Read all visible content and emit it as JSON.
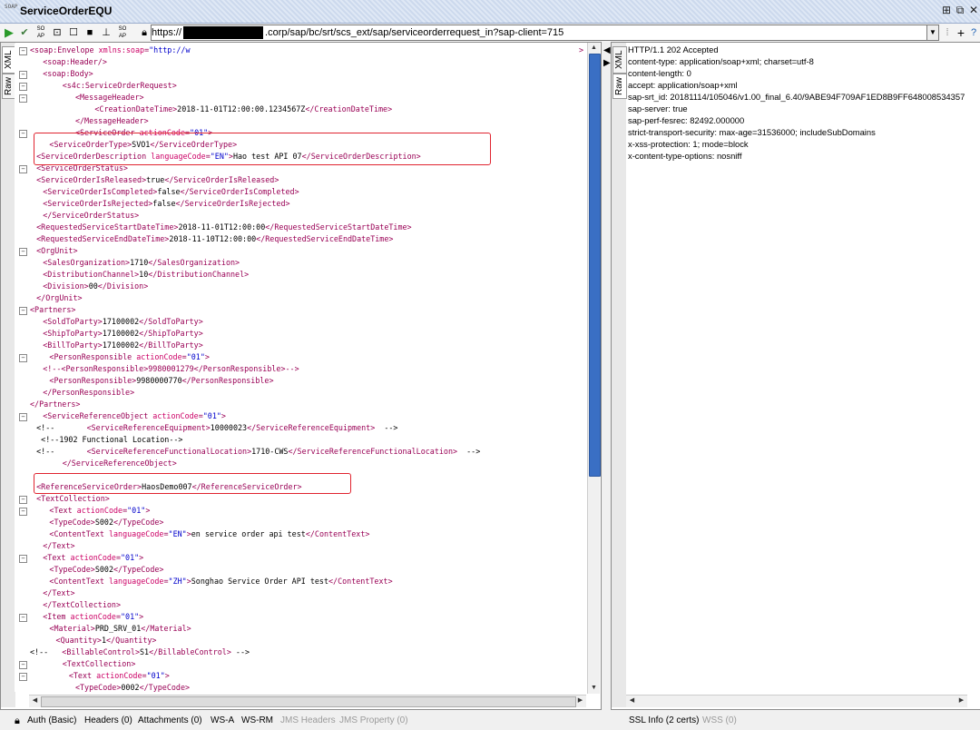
{
  "window": {
    "title": "ServiceOrderEQU",
    "logo": "SOAP"
  },
  "toolbar": {
    "url_prefix": "https://",
    "url_suffix": ".corp/sap/bc/srt/scs_ext/sap/serviceorderrequest_in?sap-client=715",
    "icons": [
      "run-icon",
      "validate-icon",
      "soap-icon",
      "format-icon",
      "stop-icon",
      "wsa-icon",
      "attach-icon",
      "lock-icon"
    ]
  },
  "request_tabs": [
    "XML",
    "Raw"
  ],
  "response_tabs": [
    "XML",
    "Raw"
  ],
  "request_xml": [
    {
      "i": 0,
      "f": "−",
      "p": [
        [
          "t",
          "<soap:Envelope "
        ],
        [
          "a",
          "xmlns:soap"
        ],
        [
          "t",
          "="
        ],
        [
          "v",
          "\"http://w"
        ]
      ],
      "tail": ">"
    },
    {
      "i": 2,
      "p": [
        [
          "t",
          "<soap:Header/>"
        ]
      ]
    },
    {
      "i": 2,
      "f": "−",
      "p": [
        [
          "t",
          "<soap:Body>"
        ]
      ]
    },
    {
      "i": 5,
      "f": "−",
      "p": [
        [
          "t",
          "<s4c:ServiceOrderRequest>"
        ]
      ]
    },
    {
      "i": 7,
      "f": "−",
      "p": [
        [
          "t",
          "<MessageHeader>"
        ]
      ]
    },
    {
      "i": 10,
      "p": [
        [
          "t",
          "<CreationDateTime>"
        ],
        [
          "x",
          "2018-11-01T12:00:00.1234567Z"
        ],
        [
          "t",
          "</CreationDateTime>"
        ]
      ]
    },
    {
      "i": 7,
      "p": [
        [
          "t",
          "</MessageHeader>"
        ]
      ]
    },
    {
      "i": 7,
      "f": "−",
      "p": [
        [
          "t",
          "<ServiceOrder "
        ],
        [
          "a",
          "actionCode"
        ],
        [
          "t",
          "="
        ],
        [
          "v",
          "\"01\""
        ],
        [
          "t",
          ">"
        ]
      ]
    },
    {
      "i": 3,
      "p": [
        [
          "t",
          "<ServiceOrderType>"
        ],
        [
          "x",
          "SVO1"
        ],
        [
          "t",
          "</ServiceOrderType>"
        ]
      ]
    },
    {
      "i": 1,
      "p": [
        [
          "t",
          "<ServiceOrderDescription "
        ],
        [
          "a",
          "languageCode"
        ],
        [
          "t",
          "="
        ],
        [
          "v",
          "\"EN\""
        ],
        [
          "t",
          ">"
        ],
        [
          "x",
          "Hao test API 07"
        ],
        [
          "t",
          "</ServiceOrderDescription>"
        ]
      ]
    },
    {
      "i": 1,
      "f": "−",
      "p": [
        [
          "t",
          "<ServiceOrderStatus>"
        ]
      ]
    },
    {
      "i": 1,
      "p": [
        [
          "t",
          "<ServiceOrderIsReleased>"
        ],
        [
          "x",
          "true"
        ],
        [
          "t",
          "</ServiceOrderIsReleased>"
        ]
      ]
    },
    {
      "i": 2,
      "p": [
        [
          "t",
          "<ServiceOrderIsCompleted>"
        ],
        [
          "x",
          "false"
        ],
        [
          "t",
          "</ServiceOrderIsCompleted>"
        ]
      ]
    },
    {
      "i": 2,
      "p": [
        [
          "t",
          "<ServiceOrderIsRejected>"
        ],
        [
          "x",
          "false"
        ],
        [
          "t",
          "</ServiceOrderIsRejected>"
        ]
      ]
    },
    {
      "i": 2,
      "p": [
        [
          "t",
          "</ServiceOrderStatus>"
        ]
      ]
    },
    {
      "i": 1,
      "p": [
        [
          "t",
          "<RequestedServiceStartDateTime>"
        ],
        [
          "x",
          "2018-11-01T12:00:00"
        ],
        [
          "t",
          "</RequestedServiceStartDateTime>"
        ]
      ]
    },
    {
      "i": 1,
      "p": [
        [
          "t",
          "<RequestedServiceEndDateTime>"
        ],
        [
          "x",
          "2018-11-10T12:00:00"
        ],
        [
          "t",
          "</RequestedServiceEndDateTime>"
        ]
      ]
    },
    {
      "i": 1,
      "f": "−",
      "p": [
        [
          "t",
          "<OrgUnit>"
        ]
      ]
    },
    {
      "i": 2,
      "p": [
        [
          "t",
          "<SalesOrganization>"
        ],
        [
          "x",
          "1710"
        ],
        [
          "t",
          "</SalesOrganization>"
        ]
      ]
    },
    {
      "i": 2,
      "p": [
        [
          "t",
          "<DistributionChannel>"
        ],
        [
          "x",
          "10"
        ],
        [
          "t",
          "</DistributionChannel>"
        ]
      ]
    },
    {
      "i": 2,
      "p": [
        [
          "t",
          "<Division>"
        ],
        [
          "x",
          "00"
        ],
        [
          "t",
          "</Division>"
        ]
      ]
    },
    {
      "i": 1,
      "p": [
        [
          "t",
          "</OrgUnit>"
        ]
      ]
    },
    {
      "i": 0,
      "f": "−",
      "p": [
        [
          "t",
          "<Partners>"
        ]
      ]
    },
    {
      "i": 2,
      "p": [
        [
          "t",
          "<SoldToParty>"
        ],
        [
          "x",
          "17100002"
        ],
        [
          "t",
          "</SoldToParty>"
        ]
      ]
    },
    {
      "i": 2,
      "p": [
        [
          "t",
          "<ShipToParty>"
        ],
        [
          "x",
          "17100002"
        ],
        [
          "t",
          "</ShipToParty>"
        ]
      ]
    },
    {
      "i": 2,
      "p": [
        [
          "t",
          "<BillToParty>"
        ],
        [
          "x",
          "17100002"
        ],
        [
          "t",
          "</BillToParty>"
        ]
      ]
    },
    {
      "i": 3,
      "f": "−",
      "p": [
        [
          "t",
          "<PersonResponsible "
        ],
        [
          "a",
          "actionCode"
        ],
        [
          "t",
          "="
        ],
        [
          "v",
          "\"01\""
        ],
        [
          "t",
          ">"
        ]
      ]
    },
    {
      "i": 2,
      "p": [
        [
          "t",
          "<!--<PersonResponsible>9980001279</PersonResponsible>-->"
        ]
      ]
    },
    {
      "i": 3,
      "p": [
        [
          "t",
          "<PersonResponsible>"
        ],
        [
          "x",
          "9980000770"
        ],
        [
          "t",
          "</PersonResponsible>"
        ]
      ]
    },
    {
      "i": 2,
      "p": [
        [
          "t",
          "</PersonResponsible>"
        ]
      ]
    },
    {
      "i": 0,
      "p": [
        [
          "t",
          "</Partners>"
        ]
      ]
    },
    {
      "i": 2,
      "f": "−",
      "p": [
        [
          "t",
          "<ServiceReferenceObject "
        ],
        [
          "a",
          "actionCode"
        ],
        [
          "t",
          "="
        ],
        [
          "v",
          "\"01\""
        ],
        [
          "t",
          ">"
        ]
      ]
    },
    {
      "i": 1,
      "p": [
        [
          "x",
          "<!--       "
        ],
        [
          "t",
          "<ServiceReferenceEquipment>"
        ],
        [
          "x",
          "10000023"
        ],
        [
          "t",
          "</ServiceReferenceEquipment>"
        ],
        [
          "x",
          "  -->"
        ]
      ]
    },
    {
      "i": 1,
      "p": [
        [
          "x",
          " <!--1902 Functional Location-->"
        ]
      ]
    },
    {
      "i": 1,
      "p": [
        [
          "x",
          "<!--       "
        ],
        [
          "t",
          "<ServiceReferenceFunctionalLocation>"
        ],
        [
          "x",
          "1710-CWS"
        ],
        [
          "t",
          "</ServiceReferenceFunctionalLocation>"
        ],
        [
          "x",
          "  -->"
        ]
      ]
    },
    {
      "i": 5,
      "p": [
        [
          "t",
          "</ServiceReferenceObject>"
        ]
      ]
    },
    {
      "i": 0,
      "p": []
    },
    {
      "i": 1,
      "p": [
        [
          "t",
          "<ReferenceServiceOrder>"
        ],
        [
          "x",
          "HaosDemo007"
        ],
        [
          "t",
          "</ReferenceServiceOrder>"
        ]
      ]
    },
    {
      "i": 1,
      "f": "−",
      "p": [
        [
          "t",
          "<TextCollection>"
        ]
      ]
    },
    {
      "i": 3,
      "f": "−",
      "p": [
        [
          "t",
          "<Text "
        ],
        [
          "a",
          "actionCode"
        ],
        [
          "t",
          "="
        ],
        [
          "v",
          "\"01\""
        ],
        [
          "t",
          ">"
        ]
      ]
    },
    {
      "i": 3,
      "p": [
        [
          "t",
          "<TypeCode>"
        ],
        [
          "x",
          "S002"
        ],
        [
          "t",
          "</TypeCode>"
        ]
      ]
    },
    {
      "i": 3,
      "p": [
        [
          "t",
          "<ContentText "
        ],
        [
          "a",
          "languageCode"
        ],
        [
          "t",
          "="
        ],
        [
          "v",
          "\"EN\""
        ],
        [
          "t",
          ">"
        ],
        [
          "x",
          "en service order api test"
        ],
        [
          "t",
          "</ContentText>"
        ]
      ]
    },
    {
      "i": 2,
      "p": [
        [
          "t",
          "</Text>"
        ]
      ]
    },
    {
      "i": 2,
      "f": "−",
      "p": [
        [
          "t",
          "<Text "
        ],
        [
          "a",
          "actionCode"
        ],
        [
          "t",
          "="
        ],
        [
          "v",
          "\"01\""
        ],
        [
          "t",
          ">"
        ]
      ]
    },
    {
      "i": 3,
      "p": [
        [
          "t",
          "<TypeCode>"
        ],
        [
          "x",
          "S002"
        ],
        [
          "t",
          "</TypeCode>"
        ]
      ]
    },
    {
      "i": 3,
      "p": [
        [
          "t",
          "<ContentText "
        ],
        [
          "a",
          "languageCode"
        ],
        [
          "t",
          "="
        ],
        [
          "v",
          "\"ZH\""
        ],
        [
          "t",
          ">"
        ],
        [
          "x",
          "Songhao Service Order API test"
        ],
        [
          "t",
          "</ContentText>"
        ]
      ]
    },
    {
      "i": 2,
      "p": [
        [
          "t",
          "</Text>"
        ]
      ]
    },
    {
      "i": 2,
      "p": [
        [
          "t",
          "</TextCollection>"
        ]
      ]
    },
    {
      "i": 2,
      "f": "−",
      "p": [
        [
          "t",
          "<Item "
        ],
        [
          "a",
          "actionCode"
        ],
        [
          "t",
          "="
        ],
        [
          "v",
          "\"01\""
        ],
        [
          "t",
          ">"
        ]
      ]
    },
    {
      "i": 3,
      "p": [
        [
          "t",
          "<Material>"
        ],
        [
          "x",
          "PRD_SRV_01"
        ],
        [
          "t",
          "</Material>"
        ]
      ]
    },
    {
      "i": 4,
      "p": [
        [
          "t",
          "<Quantity>"
        ],
        [
          "x",
          "1"
        ],
        [
          "t",
          "</Quantity>"
        ]
      ]
    },
    {
      "i": 0,
      "p": [
        [
          "x",
          "<!--   "
        ],
        [
          "t",
          "<BillableControl>"
        ],
        [
          "x",
          "S1"
        ],
        [
          "t",
          "</BillableControl>"
        ],
        [
          "x",
          " -->"
        ]
      ]
    },
    {
      "i": 5,
      "f": "−",
      "p": [
        [
          "t",
          "<TextCollection>"
        ]
      ]
    },
    {
      "i": 6,
      "f": "−",
      "p": [
        [
          "t",
          "<Text "
        ],
        [
          "a",
          "actionCode"
        ],
        [
          "t",
          "="
        ],
        [
          "v",
          "\"01\""
        ],
        [
          "t",
          ">"
        ]
      ]
    },
    {
      "i": 7,
      "p": [
        [
          "t",
          "<TypeCode>"
        ],
        [
          "x",
          "0002"
        ],
        [
          "t",
          "</TypeCode>"
        ]
      ]
    }
  ],
  "response_lines": [
    "HTTP/1.1 202 Accepted",
    "content-type: application/soap+xml; charset=utf-8",
    "content-length: 0",
    "accept: application/soap+xml",
    "sap-srt_id: 20181114/105046/v1.00_final_6.40/9ABE94F709AF1ED8B9FF648008534357",
    "sap-server: true",
    "sap-perf-fesrec: 82492.000000",
    "strict-transport-security: max-age=31536000; includeSubDomains",
    "x-xss-protection: 1; mode=block",
    "x-content-type-options: nosniff"
  ],
  "status_left": [
    {
      "label": "Auth (Basic)",
      "enabled": true
    },
    {
      "label": "Headers (0)",
      "enabled": true
    },
    {
      "label": "Attachments (0)",
      "enabled": true
    },
    {
      "label": "WS-A",
      "enabled": true
    },
    {
      "label": "WS-RM",
      "enabled": true
    },
    {
      "label": "JMS Headers",
      "enabled": false
    },
    {
      "label": "JMS Property (0)",
      "enabled": false
    }
  ],
  "status_right": [
    {
      "label": "SSL Info (2 certs)",
      "enabled": true
    },
    {
      "label": "WSS (0)",
      "enabled": false
    }
  ],
  "colors": {
    "tag": "#990055",
    "attr": "#cc0066",
    "value": "#0000cc",
    "highlight": "#e0232f",
    "scroll_thumb": "#3a6fc4"
  }
}
